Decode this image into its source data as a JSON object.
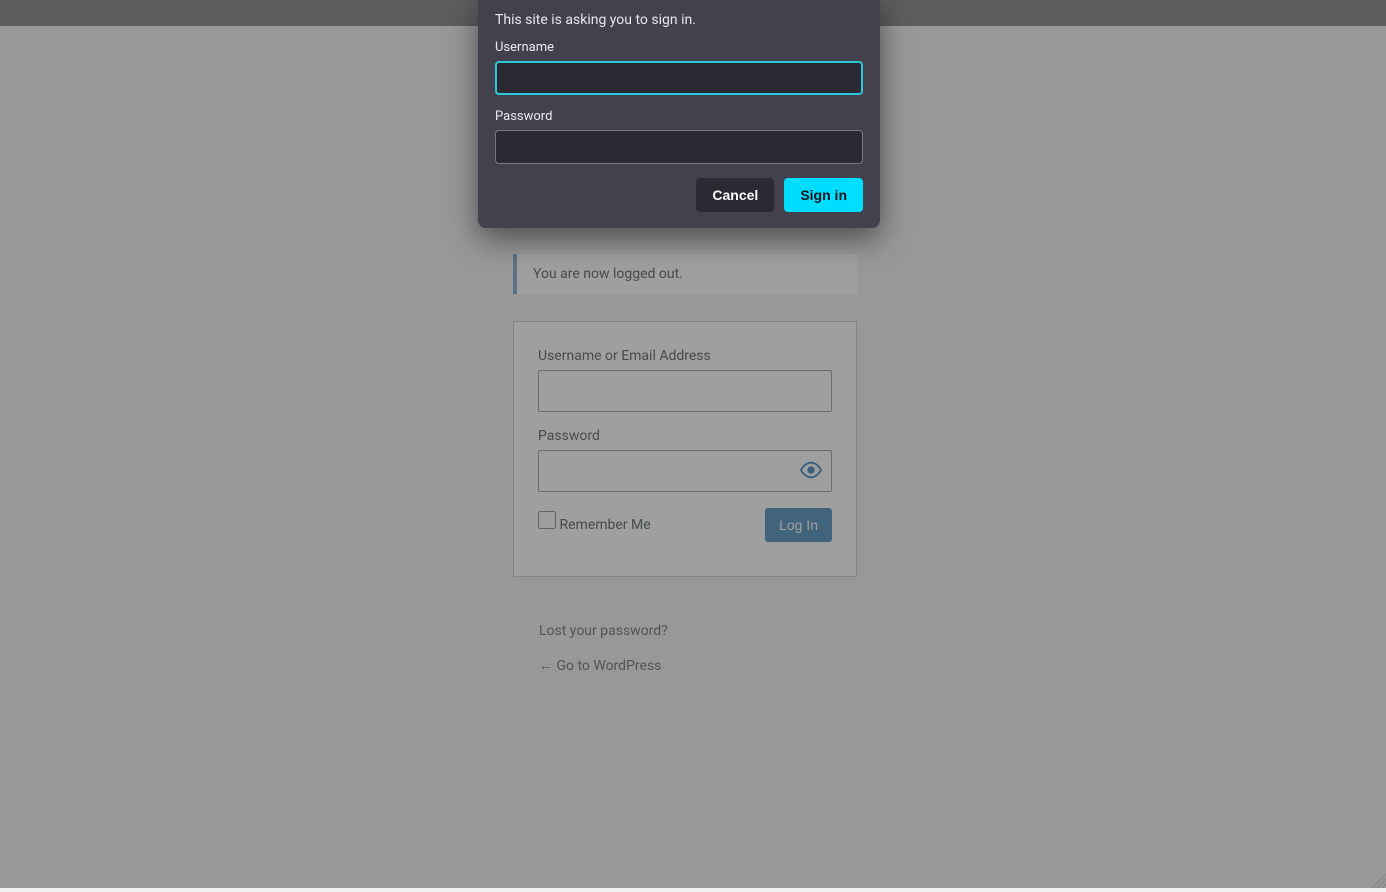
{
  "auth_dialog": {
    "prompt": "This site is asking you to sign in.",
    "username_label": "Username",
    "username_value": "",
    "password_label": "Password",
    "password_value": "",
    "cancel_label": "Cancel",
    "signin_label": "Sign in"
  },
  "notice": {
    "message": "You are now logged out."
  },
  "login_form": {
    "username_label": "Username or Email Address",
    "username_value": "",
    "password_label": "Password",
    "password_value": "",
    "remember_label": "Remember Me",
    "submit_label": "Log In"
  },
  "links": {
    "lost_password": "Lost your password?",
    "go_back": "← Go to WordPress"
  }
}
